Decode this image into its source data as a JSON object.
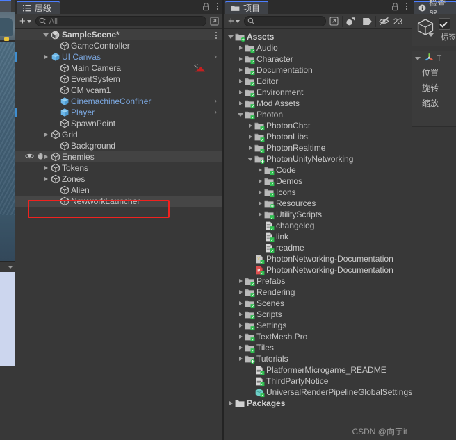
{
  "window": {
    "hierarchy_tab": "层级",
    "project_tab": "项目",
    "inspector_tab": "检查器"
  },
  "hierarchy": {
    "toolbar": {
      "add_label": "+",
      "search_placeholder": "All",
      "search_value": ""
    },
    "scene": {
      "name": "SampleScene*"
    },
    "items": [
      {
        "label": "GameController",
        "indent": 2,
        "expandable": false,
        "style": "normal",
        "chevron": false,
        "strip": false
      },
      {
        "label": "UI Canvas",
        "indent": 1,
        "expandable": true,
        "style": "blue",
        "chevron": true,
        "strip": true
      },
      {
        "label": "Main Camera",
        "indent": 2,
        "expandable": false,
        "style": "normal",
        "chevron": false,
        "strip": false,
        "camera_off": true
      },
      {
        "label": "EventSystem",
        "indent": 2,
        "expandable": false,
        "style": "normal",
        "chevron": false,
        "strip": false
      },
      {
        "label": "CM vcam1",
        "indent": 2,
        "expandable": false,
        "style": "normal",
        "chevron": false,
        "strip": false
      },
      {
        "label": "CinemachineConfiner",
        "indent": 2,
        "expandable": false,
        "style": "blue",
        "chevron": true,
        "strip": false
      },
      {
        "label": "Player",
        "indent": 2,
        "expandable": false,
        "style": "blue",
        "chevron": true,
        "strip": true
      },
      {
        "label": "SpawnPoint",
        "indent": 2,
        "expandable": false,
        "style": "normal",
        "chevron": false,
        "strip": false
      },
      {
        "label": "Grid",
        "indent": 1,
        "expandable": true,
        "style": "normal",
        "chevron": false,
        "strip": false
      },
      {
        "label": "Background",
        "indent": 2,
        "expandable": false,
        "style": "normal",
        "chevron": false,
        "strip": false
      },
      {
        "label": "Enemies",
        "indent": 1,
        "expandable": true,
        "style": "normal",
        "chevron": false,
        "strip": false,
        "hover": true
      },
      {
        "label": "Tokens",
        "indent": 1,
        "expandable": true,
        "style": "normal",
        "chevron": false,
        "strip": false
      },
      {
        "label": "Zones",
        "indent": 1,
        "expandable": true,
        "style": "normal",
        "chevron": false,
        "strip": false
      },
      {
        "label": "Alien",
        "indent": 2,
        "expandable": false,
        "style": "normal",
        "chevron": false,
        "strip": false
      },
      {
        "label": "NewworkLauncher",
        "indent": 2,
        "expandable": false,
        "style": "normal",
        "chevron": false,
        "strip": false,
        "selected": true,
        "marked": true
      }
    ]
  },
  "project": {
    "toolbar": {
      "add_label": "+",
      "search_placeholder": "",
      "search_value": "",
      "hidden_count": "23"
    },
    "items": [
      {
        "label": "Assets",
        "indent": 0,
        "icon": "folder",
        "badge": "add",
        "expand": "open",
        "bold": true
      },
      {
        "label": "Audio",
        "indent": 1,
        "icon": "folder",
        "badge": "edit",
        "expand": "closed"
      },
      {
        "label": "Character",
        "indent": 1,
        "icon": "folder",
        "badge": "edit",
        "expand": "closed"
      },
      {
        "label": "Documentation",
        "indent": 1,
        "icon": "folder",
        "badge": "edit",
        "expand": "closed"
      },
      {
        "label": "Editor",
        "indent": 1,
        "icon": "folder",
        "badge": "edit",
        "expand": "closed"
      },
      {
        "label": "Environment",
        "indent": 1,
        "icon": "folder",
        "badge": "edit",
        "expand": "closed"
      },
      {
        "label": "Mod Assets",
        "indent": 1,
        "icon": "folder",
        "badge": "edit",
        "expand": "closed"
      },
      {
        "label": "Photon",
        "indent": 1,
        "icon": "folder",
        "badge": "edit",
        "expand": "open"
      },
      {
        "label": "PhotonChat",
        "indent": 2,
        "icon": "folder",
        "badge": "edit",
        "expand": "closed"
      },
      {
        "label": "PhotonLibs",
        "indent": 2,
        "icon": "folder",
        "badge": "edit",
        "expand": "closed"
      },
      {
        "label": "PhotonRealtime",
        "indent": 2,
        "icon": "folder",
        "badge": "edit",
        "expand": "closed"
      },
      {
        "label": "PhotonUnityNetworking",
        "indent": 2,
        "icon": "folder",
        "badge": "add",
        "expand": "open"
      },
      {
        "label": "Code",
        "indent": 3,
        "icon": "folder",
        "badge": "edit",
        "expand": "closed"
      },
      {
        "label": "Demos",
        "indent": 3,
        "icon": "folder",
        "badge": "edit",
        "expand": "closed"
      },
      {
        "label": "Icons",
        "indent": 3,
        "icon": "folder",
        "badge": "edit",
        "expand": "closed"
      },
      {
        "label": "Resources",
        "indent": 3,
        "icon": "folder",
        "badge": "add",
        "expand": "closed"
      },
      {
        "label": "UtilityScripts",
        "indent": 3,
        "icon": "folder",
        "badge": "edit",
        "expand": "closed"
      },
      {
        "label": "changelog",
        "indent": 3,
        "icon": "text",
        "badge": "edit",
        "expand": "none"
      },
      {
        "label": "link",
        "indent": 3,
        "icon": "text",
        "badge": "edit",
        "expand": "none"
      },
      {
        "label": "readme",
        "indent": 3,
        "icon": "text",
        "badge": "edit",
        "expand": "none"
      },
      {
        "label": "PhotonNetworking-Documentation",
        "indent": 2,
        "icon": "chm",
        "badge": "edit",
        "expand": "none"
      },
      {
        "label": "PhotonNetworking-Documentation",
        "indent": 2,
        "icon": "pdf",
        "badge": "edit",
        "expand": "none"
      },
      {
        "label": "Prefabs",
        "indent": 1,
        "icon": "folder",
        "badge": "edit",
        "expand": "closed"
      },
      {
        "label": "Rendering",
        "indent": 1,
        "icon": "folder",
        "badge": "edit",
        "expand": "closed"
      },
      {
        "label": "Scenes",
        "indent": 1,
        "icon": "folder",
        "badge": "edit",
        "expand": "closed"
      },
      {
        "label": "Scripts",
        "indent": 1,
        "icon": "folder",
        "badge": "edit",
        "expand": "closed"
      },
      {
        "label": "Settings",
        "indent": 1,
        "icon": "folder",
        "badge": "edit",
        "expand": "closed"
      },
      {
        "label": "TextMesh Pro",
        "indent": 1,
        "icon": "folder",
        "badge": "edit",
        "expand": "closed"
      },
      {
        "label": "Tiles",
        "indent": 1,
        "icon": "folder",
        "badge": "edit",
        "expand": "closed"
      },
      {
        "label": "Tutorials",
        "indent": 1,
        "icon": "folder",
        "badge": "add",
        "expand": "closed"
      },
      {
        "label": "PlatformerMicrogame_README",
        "indent": 2,
        "icon": "text",
        "badge": "edit",
        "expand": "none"
      },
      {
        "label": "ThirdPartyNotice",
        "indent": 2,
        "icon": "text",
        "badge": "edit",
        "expand": "none"
      },
      {
        "label": "UniversalRenderPipelineGlobalSettings",
        "indent": 2,
        "icon": "asset",
        "badge": "edit",
        "expand": "none"
      },
      {
        "label": "Packages",
        "indent": 0,
        "icon": "folder-plain",
        "badge": "none",
        "expand": "closed",
        "bold": true
      }
    ]
  },
  "inspector": {
    "tag_label": "标签",
    "transform_rows": [
      "位置",
      "旋转",
      "缩放"
    ]
  },
  "watermark": "CSDN @向宇it",
  "colors": {
    "panel_bg": "#383838",
    "toolbar_bg": "#3b3b3b",
    "tab_active": "#3f4247",
    "accent_blue": "#4c7eff",
    "prefab_blue": "#7ba7df",
    "marker_red": "#f0221f",
    "vcs_green": "#2ebd4e"
  }
}
